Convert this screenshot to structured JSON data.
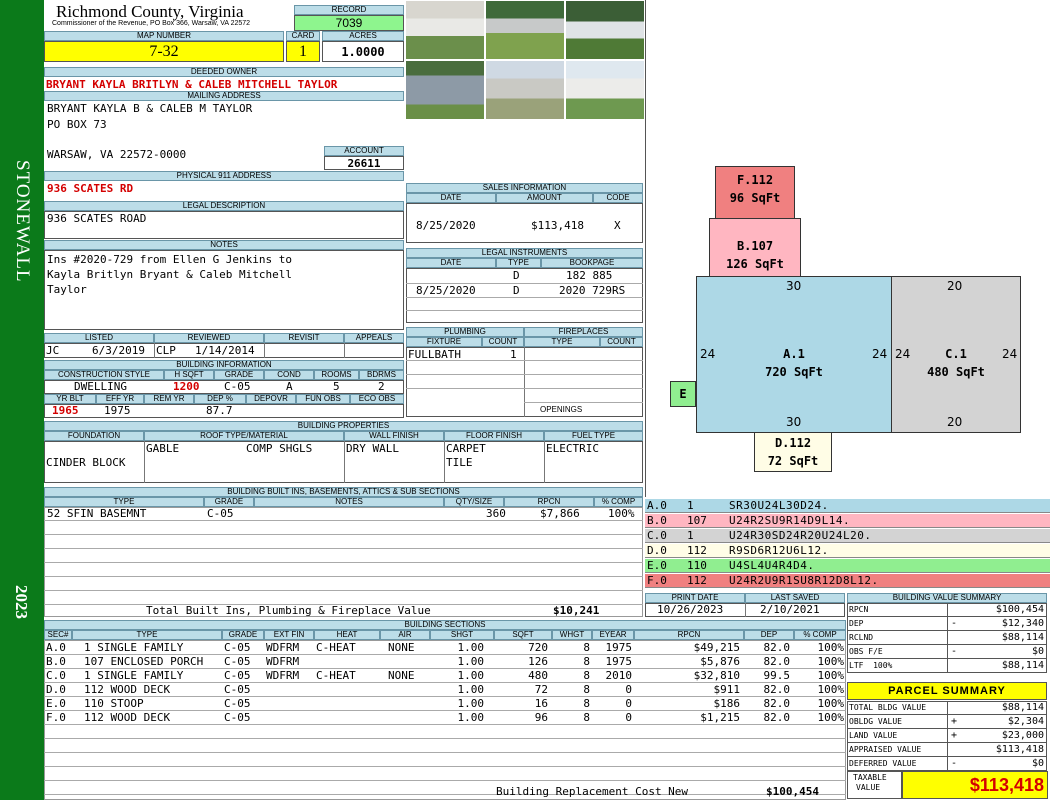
{
  "sidebar": {
    "district": "STONEWALL",
    "year": "2023",
    "color": "#0b7a1a"
  },
  "header": {
    "county": "Richmond County, Virginia",
    "subtitle": "Commissioner of the Revenue, PO Box 366, Warsaw, VA 22572",
    "record_label": "RECORD",
    "record": "7039",
    "map_label": "MAP NUMBER",
    "map_number": "7-32",
    "card_label": "CARD",
    "card": "1",
    "acres_label": "ACRES",
    "acres": "1.0000"
  },
  "owner": {
    "label": "DEEDED OWNER",
    "name": "BRYANT KAYLA BRITLYN & CALEB MITCHELL TAYLOR",
    "mail_label": "MAILING ADDRESS",
    "mail1": "BRYANT KAYLA B & CALEB M TAYLOR",
    "mail2": "PO BOX 73",
    "mail3": "WARSAW, VA 22572-0000",
    "account_label": "ACCOUNT",
    "account": "26611"
  },
  "address": {
    "label": "PHYSICAL 911 ADDRESS",
    "value": "936 SCATES RD"
  },
  "legal": {
    "label": "LEGAL DESCRIPTION",
    "value": "936 SCATES ROAD"
  },
  "notes": {
    "label": "NOTES",
    "lines": [
      "Ins #2020-729 from Ellen G Jenkins to",
      "Kayla Britlyn Bryant & Caleb Mitchell",
      "Taylor"
    ]
  },
  "sales": {
    "label": "SALES INFORMATION",
    "cols": [
      "DATE",
      "AMOUNT",
      "CODE"
    ],
    "row": [
      "8/25/2020",
      "$113,418",
      "X"
    ]
  },
  "instruments": {
    "label": "LEGAL INSTRUMENTS",
    "cols": [
      "DATE",
      "TYPE",
      "BOOKPAGE"
    ],
    "rows": [
      [
        "",
        "D",
        "182 885"
      ],
      [
        "8/25/2020",
        "D",
        "2020 729RS"
      ]
    ]
  },
  "plumbing": {
    "label": "PLUMBING",
    "cols": [
      "FIXTURE",
      "COUNT"
    ],
    "row": [
      "FULLBATH",
      "1"
    ]
  },
  "fireplaces": {
    "label": "FIREPLACES",
    "cols": [
      "TYPE",
      "COUNT"
    ],
    "openings": "OPENINGS"
  },
  "review": {
    "cols": [
      "LISTED",
      "REVIEWED",
      "REVISIT",
      "APPEALS"
    ],
    "vals": [
      "JC",
      "6/3/2019",
      "CLP",
      "1/14/2014"
    ]
  },
  "buildinfo": {
    "label": "BUILDING INFORMATION",
    "cols": [
      "CONSTRUCTION STYLE",
      "H SQFT",
      "GRADE",
      "COND",
      "ROOMS",
      "BDRMS"
    ],
    "vals": [
      "DWELLING",
      "1200",
      "C-05",
      "A",
      "5",
      "2"
    ],
    "cols2": [
      "YR BLT",
      "EFF YR",
      "REM YR",
      "DEP %",
      "DEPOVR",
      "FUN OBS",
      "ECO OBS"
    ],
    "vals2": [
      "1965",
      "1975",
      "",
      "87.7",
      "",
      "",
      ""
    ]
  },
  "props": {
    "label": "BUILDING PROPERTIES",
    "cols": [
      "FOUNDATION",
      "ROOF TYPE/MATERIAL",
      "WALL FINISH",
      "FLOOR FINISH",
      "FUEL TYPE"
    ],
    "foundation": "CINDER BLOCK",
    "roof1": "GABLE",
    "roof2": "COMP SHGLS",
    "wall": "DRY WALL",
    "floor1": "CARPET",
    "floor2": "TILE",
    "fuel": "ELECTRIC"
  },
  "builtins": {
    "label": "BUILDING BUILT INS, BASEMENTS, ATTICS & SUB SECTIONS",
    "cols": [
      "TYPE",
      "GRADE",
      "NOTES",
      "QTY/SIZE",
      "RPCN",
      "% COMP"
    ],
    "row": [
      "52 SFIN BASEMNT",
      "C-05",
      "",
      "360",
      "$7,866",
      "100%"
    ],
    "total_label": "Total Built Ins, Plumbing & Fireplace Value",
    "total": "$10,241"
  },
  "sections": {
    "label": "BUILDING SECTIONS",
    "cols": [
      "SEC#",
      "TYPE",
      "GRADE",
      "EXT FIN",
      "HEAT",
      "AIR",
      "SHGT",
      "SQFT",
      "WHGT",
      "EYEAR",
      "RPCN",
      "DEP",
      "% COMP"
    ],
    "rows": [
      [
        "A.0",
        "1 SINGLE FAMILY",
        "C-05",
        "WDFRM",
        "C-HEAT",
        "NONE",
        "1.00",
        "720",
        "8",
        "1975",
        "$49,215",
        "82.0",
        "100%"
      ],
      [
        "B.0",
        "107 ENCLOSED PORCH",
        "C-05",
        "WDFRM",
        "",
        "",
        "1.00",
        "126",
        "8",
        "1975",
        "$5,876",
        "82.0",
        "100%"
      ],
      [
        "C.0",
        "1 SINGLE FAMILY",
        "C-05",
        "WDFRM",
        "C-HEAT",
        "NONE",
        "1.00",
        "480",
        "8",
        "2010",
        "$32,810",
        "99.5",
        "100%"
      ],
      [
        "D.0",
        "112 WOOD DECK",
        "C-05",
        "",
        "",
        "",
        "1.00",
        "72",
        "8",
        "0",
        "$911",
        "82.0",
        "100%"
      ],
      [
        "E.0",
        "110 STOOP",
        "C-05",
        "",
        "",
        "",
        "1.00",
        "16",
        "8",
        "0",
        "$186",
        "82.0",
        "100%"
      ],
      [
        "F.0",
        "112 WOOD DECK",
        "C-05",
        "",
        "",
        "",
        "1.00",
        "96",
        "8",
        "0",
        "$1,215",
        "82.0",
        "100%"
      ]
    ],
    "total_label": "Building Replacement Cost New",
    "total": "$100,454"
  },
  "sketch": {
    "F": {
      "id": "F.112",
      "area": "96 SqFt"
    },
    "B": {
      "id": "B.107",
      "area": "126 SqFt"
    },
    "A": {
      "id": "A.1",
      "area": "720 SqFt"
    },
    "C": {
      "id": "C.1",
      "area": "480 SqFt"
    },
    "D": {
      "id": "D.112",
      "area": "72 SqFt"
    },
    "E": {
      "id": "E"
    },
    "dims": {
      "a_top": "30",
      "a_bottom": "30",
      "a_left": "24",
      "a_right": "24",
      "c_top": "20",
      "c_bottom": "20",
      "c_left": "24",
      "c_right": "24"
    }
  },
  "legend": [
    {
      "sec": "A.0",
      "code": "1",
      "vec": "SR30U24L30D24.",
      "color": "#add8e6"
    },
    {
      "sec": "B.0",
      "code": "107",
      "vec": "U24R2SU9R14D9L14.",
      "color": "#ffb6c1"
    },
    {
      "sec": "C.0",
      "code": "1",
      "vec": "U24R30SD24R20U24L20.",
      "color": "#d3d3d3"
    },
    {
      "sec": "D.0",
      "code": "112",
      "vec": "R9SD6R12U6L12.",
      "color": "#fffde6"
    },
    {
      "sec": "E.0",
      "code": "110",
      "vec": "U4SL4U4R4D4.",
      "color": "#90ee90"
    },
    {
      "sec": "F.0",
      "code": "112",
      "vec": "U24R2U9R1SU8R12D8L12.",
      "color": "#f08080"
    }
  ],
  "dates": {
    "print_label": "PRINT DATE",
    "print": "10/26/2023",
    "saved_label": "LAST SAVED",
    "saved": "2/10/2021"
  },
  "bvs": {
    "label": "BUILDING VALUE SUMMARY",
    "rows": [
      [
        "RPCN",
        "",
        "$100,454"
      ],
      [
        "DEP",
        "-",
        "$12,340"
      ],
      [
        "RCLND",
        "",
        "$88,114"
      ],
      [
        "OBS F/E",
        "-",
        "$0"
      ],
      [
        "LTF  100%",
        "",
        "$88,114"
      ]
    ]
  },
  "parcel": {
    "label": "PARCEL SUMMARY",
    "rows": [
      [
        "TOTAL BLDG VALUE",
        "",
        "$88,114"
      ],
      [
        "OBLDG VALUE",
        "+",
        "$2,304"
      ],
      [
        "LAND VALUE",
        "+",
        "$23,000"
      ],
      [
        "APPRAISED VALUE",
        "",
        "$113,418"
      ],
      [
        "DEFERRED VALUE",
        "-",
        "$0"
      ]
    ],
    "taxable_label1": "TAXABLE",
    "taxable_label2": "VALUE",
    "taxable": "$113,418"
  }
}
